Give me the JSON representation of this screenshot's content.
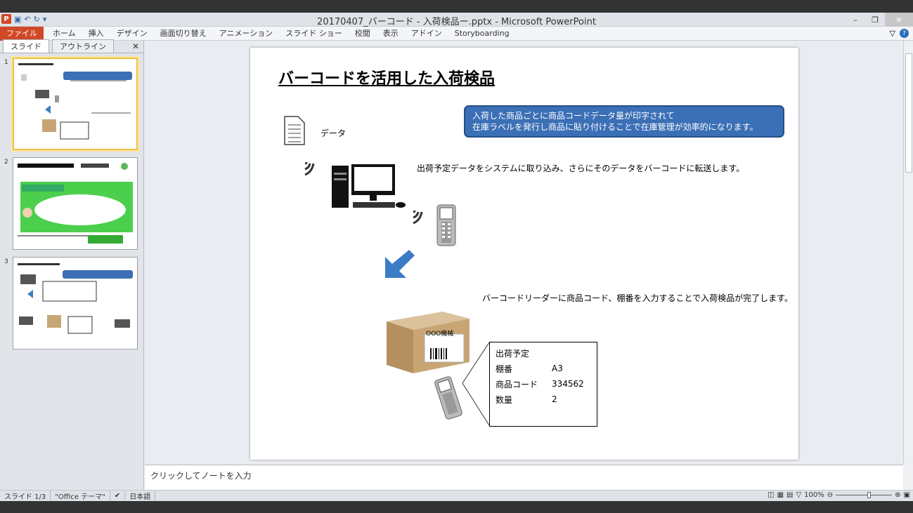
{
  "window": {
    "title": "20170407_バーコード - 入荷検品ー.pptx - Microsoft PowerPoint"
  },
  "ribbon": {
    "tabs": [
      "ファイル",
      "ホーム",
      "挿入",
      "デザイン",
      "画面切り替え",
      "アニメーション",
      "スライド ショー",
      "校閲",
      "表示",
      "アドイン",
      "Storyboarding"
    ]
  },
  "sidepane": {
    "tabs": [
      "スライド",
      "アウトライン"
    ],
    "slide_numbers": [
      "1",
      "2",
      "3"
    ]
  },
  "slide": {
    "title": "バーコードを活用した入荷検品",
    "callout_line1": "入荷した商品ごとに商品コードデータ量が印字されて",
    "callout_line2": "在庫ラベルを発行し商品に貼り付けることで在庫管理が効率的になります。",
    "doc_label": "データ",
    "text1": "出荷予定データをシステムに取り込み、さらにそのデータをバーコードに転送します。",
    "text2": "バーコードリーダーに商品コード、棚番を入力することで入荷検品が完了します。",
    "box_label": "OOO機械",
    "info": {
      "header": "出荷予定",
      "rows": [
        {
          "k": "棚番",
          "v": "A3"
        },
        {
          "k": "商品コード",
          "v": "334562"
        },
        {
          "k": "数量",
          "v": "2"
        }
      ]
    }
  },
  "notes": {
    "placeholder": "クリックしてノートを入力"
  },
  "status": {
    "slide": "スライド 1/3",
    "theme": "\"Office テーマ\"",
    "lang": "日本語",
    "zoom": "100%"
  }
}
